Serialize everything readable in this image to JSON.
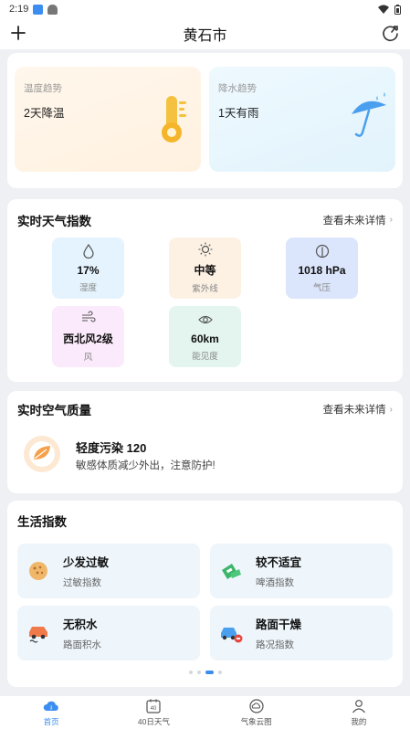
{
  "status": {
    "time": "2:19"
  },
  "header": {
    "city": "黄石市"
  },
  "trends": [
    {
      "label": "温度趋势",
      "value": "2天降温"
    },
    {
      "label": "降水趋势",
      "value": "1天有雨"
    }
  ],
  "realtime": {
    "title": "实时天气指数",
    "more": "查看未来详情",
    "items": [
      {
        "value": "17%",
        "label": "湿度"
      },
      {
        "value": "中等",
        "label": "紫外线"
      },
      {
        "value": "1018 hPa",
        "label": "气压"
      },
      {
        "value": "西北风2级",
        "label": "风"
      },
      {
        "value": "60km",
        "label": "能见度"
      }
    ]
  },
  "air": {
    "title": "实时空气质量",
    "more": "查看未来详情",
    "level": "轻度污染 120",
    "advice": "敏感体质减少外出，注意防护!"
  },
  "life": {
    "title": "生活指数",
    "items": [
      {
        "title": "少发过敏",
        "sub": "过敏指数"
      },
      {
        "title": "较不适宜",
        "sub": "啤酒指数"
      },
      {
        "title": "无积水",
        "sub": "路面积水"
      },
      {
        "title": "路面干燥",
        "sub": "路况指数"
      }
    ],
    "page_index": 3,
    "page_count": 4
  },
  "tabs": [
    {
      "label": "首页",
      "icon": "cloud-home-icon"
    },
    {
      "label": "40日天气",
      "icon": "calendar-40-icon"
    },
    {
      "label": "气象云图",
      "icon": "cloud-map-icon"
    },
    {
      "label": "我的",
      "icon": "profile-icon"
    }
  ],
  "colors": {
    "accent": "#3b8ef0",
    "humidity_bg": "#e4f3fd",
    "uv_bg": "#fdf1e4",
    "pressure_bg": "#dbe5fb",
    "wind_bg": "#fbeafb",
    "visibility_bg": "#e3f5ee",
    "life_bg": "#eef6fc"
  }
}
